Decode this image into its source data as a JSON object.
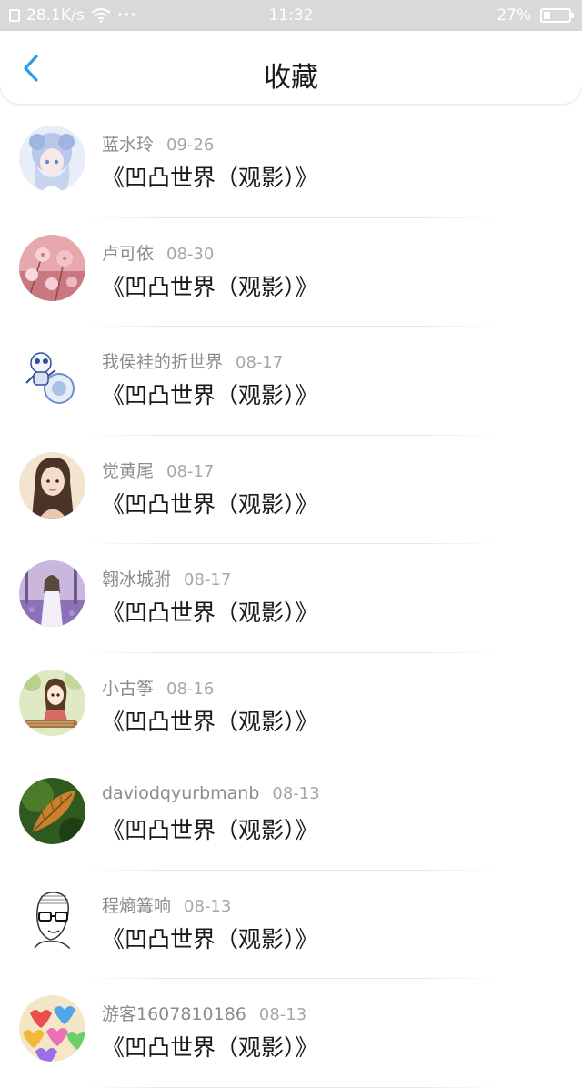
{
  "status_bar": {
    "speed": "28.1K/s",
    "dots": "···",
    "time": "11:32",
    "battery_percent_label": "27%",
    "battery_level": 0.27
  },
  "header": {
    "back_icon": "chevron-left-icon",
    "title": "收藏",
    "accent_color": "#2b9bf0"
  },
  "list": [
    {
      "user": "蓝水玲",
      "date": "09-26",
      "title": "《凹凸世界（观影）》",
      "avatar": "anime-girl-blue-avatar"
    },
    {
      "user": "卢可依",
      "date": "08-30",
      "title": "《凹凸世界（观影）》",
      "avatar": "pink-flowers-avatar"
    },
    {
      "user": "我侯袿的折世界",
      "date": "08-17",
      "title": "《凹凸世界（观影）》",
      "avatar": "blue-robot-avatar"
    },
    {
      "user": "觉黄尾",
      "date": "08-17",
      "title": "《凹凸世界（观影）》",
      "avatar": "girl-portrait-avatar"
    },
    {
      "user": "翱冰城驸",
      "date": "08-17",
      "title": "《凹凸世界（观影）》",
      "avatar": "lavender-field-avatar"
    },
    {
      "user": "小古筝",
      "date": "08-16",
      "title": "《凹凸世界（观影）》",
      "avatar": "anime-guzheng-avatar"
    },
    {
      "user": "daviodqyurbmanb",
      "date": "08-13",
      "title": "《凹凸世界（观影）》",
      "avatar": "autumn-leaf-avatar"
    },
    {
      "user": "程熵篝响",
      "date": "08-13",
      "title": "《凹凸世界（观影）》",
      "avatar": "sketch-man-avatar"
    },
    {
      "user": "游客1607810186",
      "date": "08-13",
      "title": "《凹凸世界（观影）》",
      "avatar": "colorful-hearts-avatar"
    }
  ]
}
